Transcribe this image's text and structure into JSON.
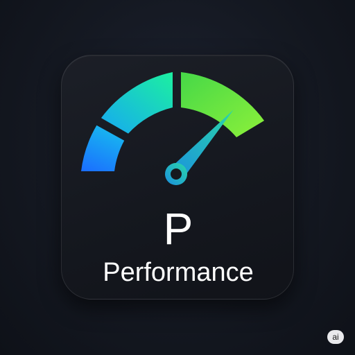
{
  "icon": {
    "letter": "P",
    "name": "Performance",
    "gauge_level": 0.8
  },
  "badge": {
    "label": "ai"
  },
  "colors": {
    "background": "#141821",
    "tile": "#181b22",
    "segment_blue": "#1a8cff",
    "segment_cyan": "#1ad6c0",
    "segment_green": "#5be03a",
    "needle": "#1fb5d8",
    "text": "#ffffff"
  },
  "icons": [
    "speedometer-icon"
  ]
}
